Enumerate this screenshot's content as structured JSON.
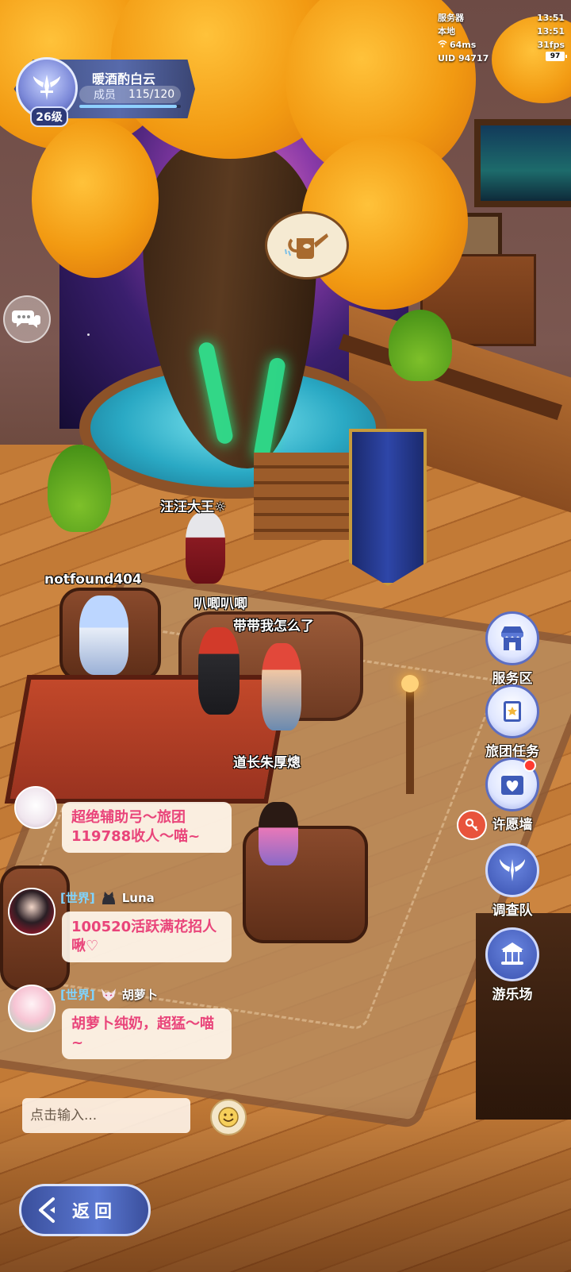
{
  "guild": {
    "level": "26级",
    "name": "暖酒酌白云",
    "members_label": "成员",
    "members_count": "115/120",
    "members_fill": 0.958
  },
  "stats": {
    "server_label": "服务器",
    "server_time": "13:51",
    "local_label": "本地",
    "local_time": "13:51",
    "ping": "64ms",
    "fps": "31fps",
    "uid": "UID 94717",
    "battery": "97"
  },
  "nametags": {
    "wangwang": "汪汪大王☼",
    "notfound": "notfound404",
    "bazhi": "叭唧叭唧",
    "daidai": "带带我怎么了",
    "daozhang": "道长朱厚熜"
  },
  "side_menu": [
    {
      "label": "服务区",
      "icon": "shop-icon"
    },
    {
      "label": "旅团任务",
      "icon": "task-book-icon"
    },
    {
      "label": "许愿墙",
      "icon": "wish-wall-icon",
      "badge": true
    },
    {
      "label": "调查队",
      "icon": "wings-emblem-icon"
    },
    {
      "label": "游乐场",
      "icon": "carousel-icon"
    }
  ],
  "chat": {
    "messages": [
      {
        "channel": "",
        "user": "",
        "text": "超绝辅助弓～旅团119788收人～喵~"
      },
      {
        "channel": "[世界]",
        "user": "Luna",
        "text": "100520活跃满花招人啾♡"
      },
      {
        "channel": "[世界]",
        "user": "胡萝卜",
        "text": "胡萝卜纯奶，超猛～喵~"
      }
    ],
    "input_placeholder": "点击输入..."
  },
  "back_button": {
    "label": "返回"
  },
  "colors": {
    "accent_blue": "#4a66b8",
    "chat_text_pink": "#e9447a",
    "channel_blue": "#7fd4ff",
    "leaf_orange": "#f29a12"
  }
}
